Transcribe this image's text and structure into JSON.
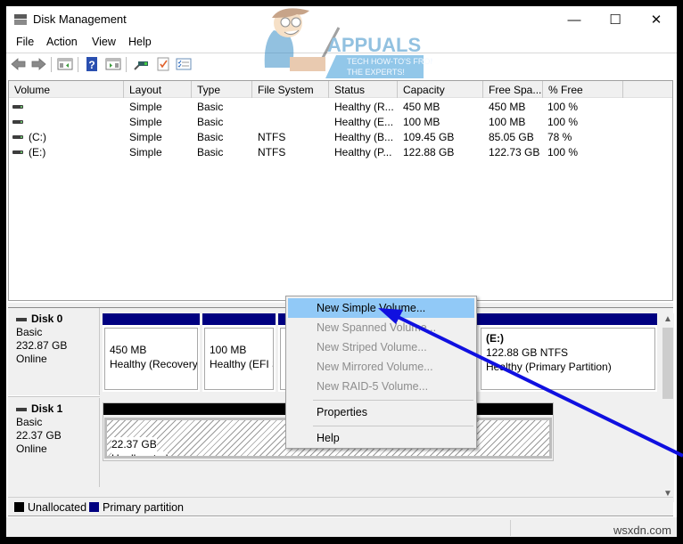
{
  "window": {
    "title": "Disk Management",
    "controls": {
      "minimize": "—",
      "maximize": "☐",
      "close": "✕"
    }
  },
  "menubar": [
    "File",
    "Action",
    "View",
    "Help"
  ],
  "toolbar": {
    "icons": [
      "back-arrow-icon",
      "forward-arrow-icon",
      "show-hide-console-tree-icon",
      "help-icon",
      "show-hide-action-pane-icon",
      "connect-icon",
      "properties-icon",
      "checklist-icon"
    ]
  },
  "logo": {
    "brand": "APPUALS",
    "tagline_1": "TECH HOW-TO'S FROM",
    "tagline_2": "THE EXPERTS!"
  },
  "volume_list": {
    "columns": [
      "Volume",
      "Layout",
      "Type",
      "File System",
      "Status",
      "Capacity",
      "Free Spa...",
      "% Free"
    ],
    "rows": [
      {
        "volume": "",
        "layout": "Simple",
        "type": "Basic",
        "fs": "",
        "status": "Healthy (R...",
        "capacity": "450 MB",
        "free": "450 MB",
        "pct": "100 %"
      },
      {
        "volume": "",
        "layout": "Simple",
        "type": "Basic",
        "fs": "",
        "status": "Healthy (E...",
        "capacity": "100 MB",
        "free": "100 MB",
        "pct": "100 %"
      },
      {
        "volume": "(C:)",
        "layout": "Simple",
        "type": "Basic",
        "fs": "NTFS",
        "status": "Healthy (B...",
        "capacity": "109.45 GB",
        "free": "85.05 GB",
        "pct": "78 %"
      },
      {
        "volume": "(E:)",
        "layout": "Simple",
        "type": "Basic",
        "fs": "NTFS",
        "status": "Healthy (P...",
        "capacity": "122.88 GB",
        "free": "122.73 GB",
        "pct": "100 %"
      }
    ]
  },
  "disks": [
    {
      "name": "Disk 0",
      "type": "Basic",
      "size": "232.87 GB",
      "state": "Online",
      "partitions": [
        {
          "line1": "450 MB",
          "line2": "Healthy (Recovery",
          "line3": ""
        },
        {
          "line1": "100 MB",
          "line2": "Healthy (EFI S",
          "line3": ""
        },
        {
          "line1": "",
          "line2": "",
          "line3": ""
        },
        {
          "line1": "(E:)",
          "line2": "122.88 GB NTFS",
          "line3": "Healthy (Primary Partition)"
        }
      ]
    },
    {
      "name": "Disk 1",
      "type": "Basic",
      "size": "22.37 GB",
      "state": "Online",
      "partitions": [
        {
          "line1": "22.37 GB",
          "line2": "Unallocated"
        }
      ]
    }
  ],
  "legend": [
    {
      "label": "Unallocated",
      "color": "#000000"
    },
    {
      "label": "Primary partition",
      "color": "#000080"
    }
  ],
  "context_menu": {
    "items": [
      {
        "label": "New Simple Volume...",
        "state": "highlighted"
      },
      {
        "label": "New Spanned Volume...",
        "state": "disabled"
      },
      {
        "label": "New Striped Volume...",
        "state": "disabled"
      },
      {
        "label": "New Mirrored Volume...",
        "state": "disabled"
      },
      {
        "label": "New RAID-5 Volume...",
        "state": "disabled"
      },
      {
        "label": "Properties",
        "state": "enabled"
      },
      {
        "label": "Help",
        "state": "enabled"
      }
    ]
  },
  "colors": {
    "primary_partition": "#000080",
    "unallocated": "#000000",
    "menu_highlight": "#91c9f7",
    "annotation_arrow": "#1010e0"
  },
  "watermark": "wsxdn.com"
}
